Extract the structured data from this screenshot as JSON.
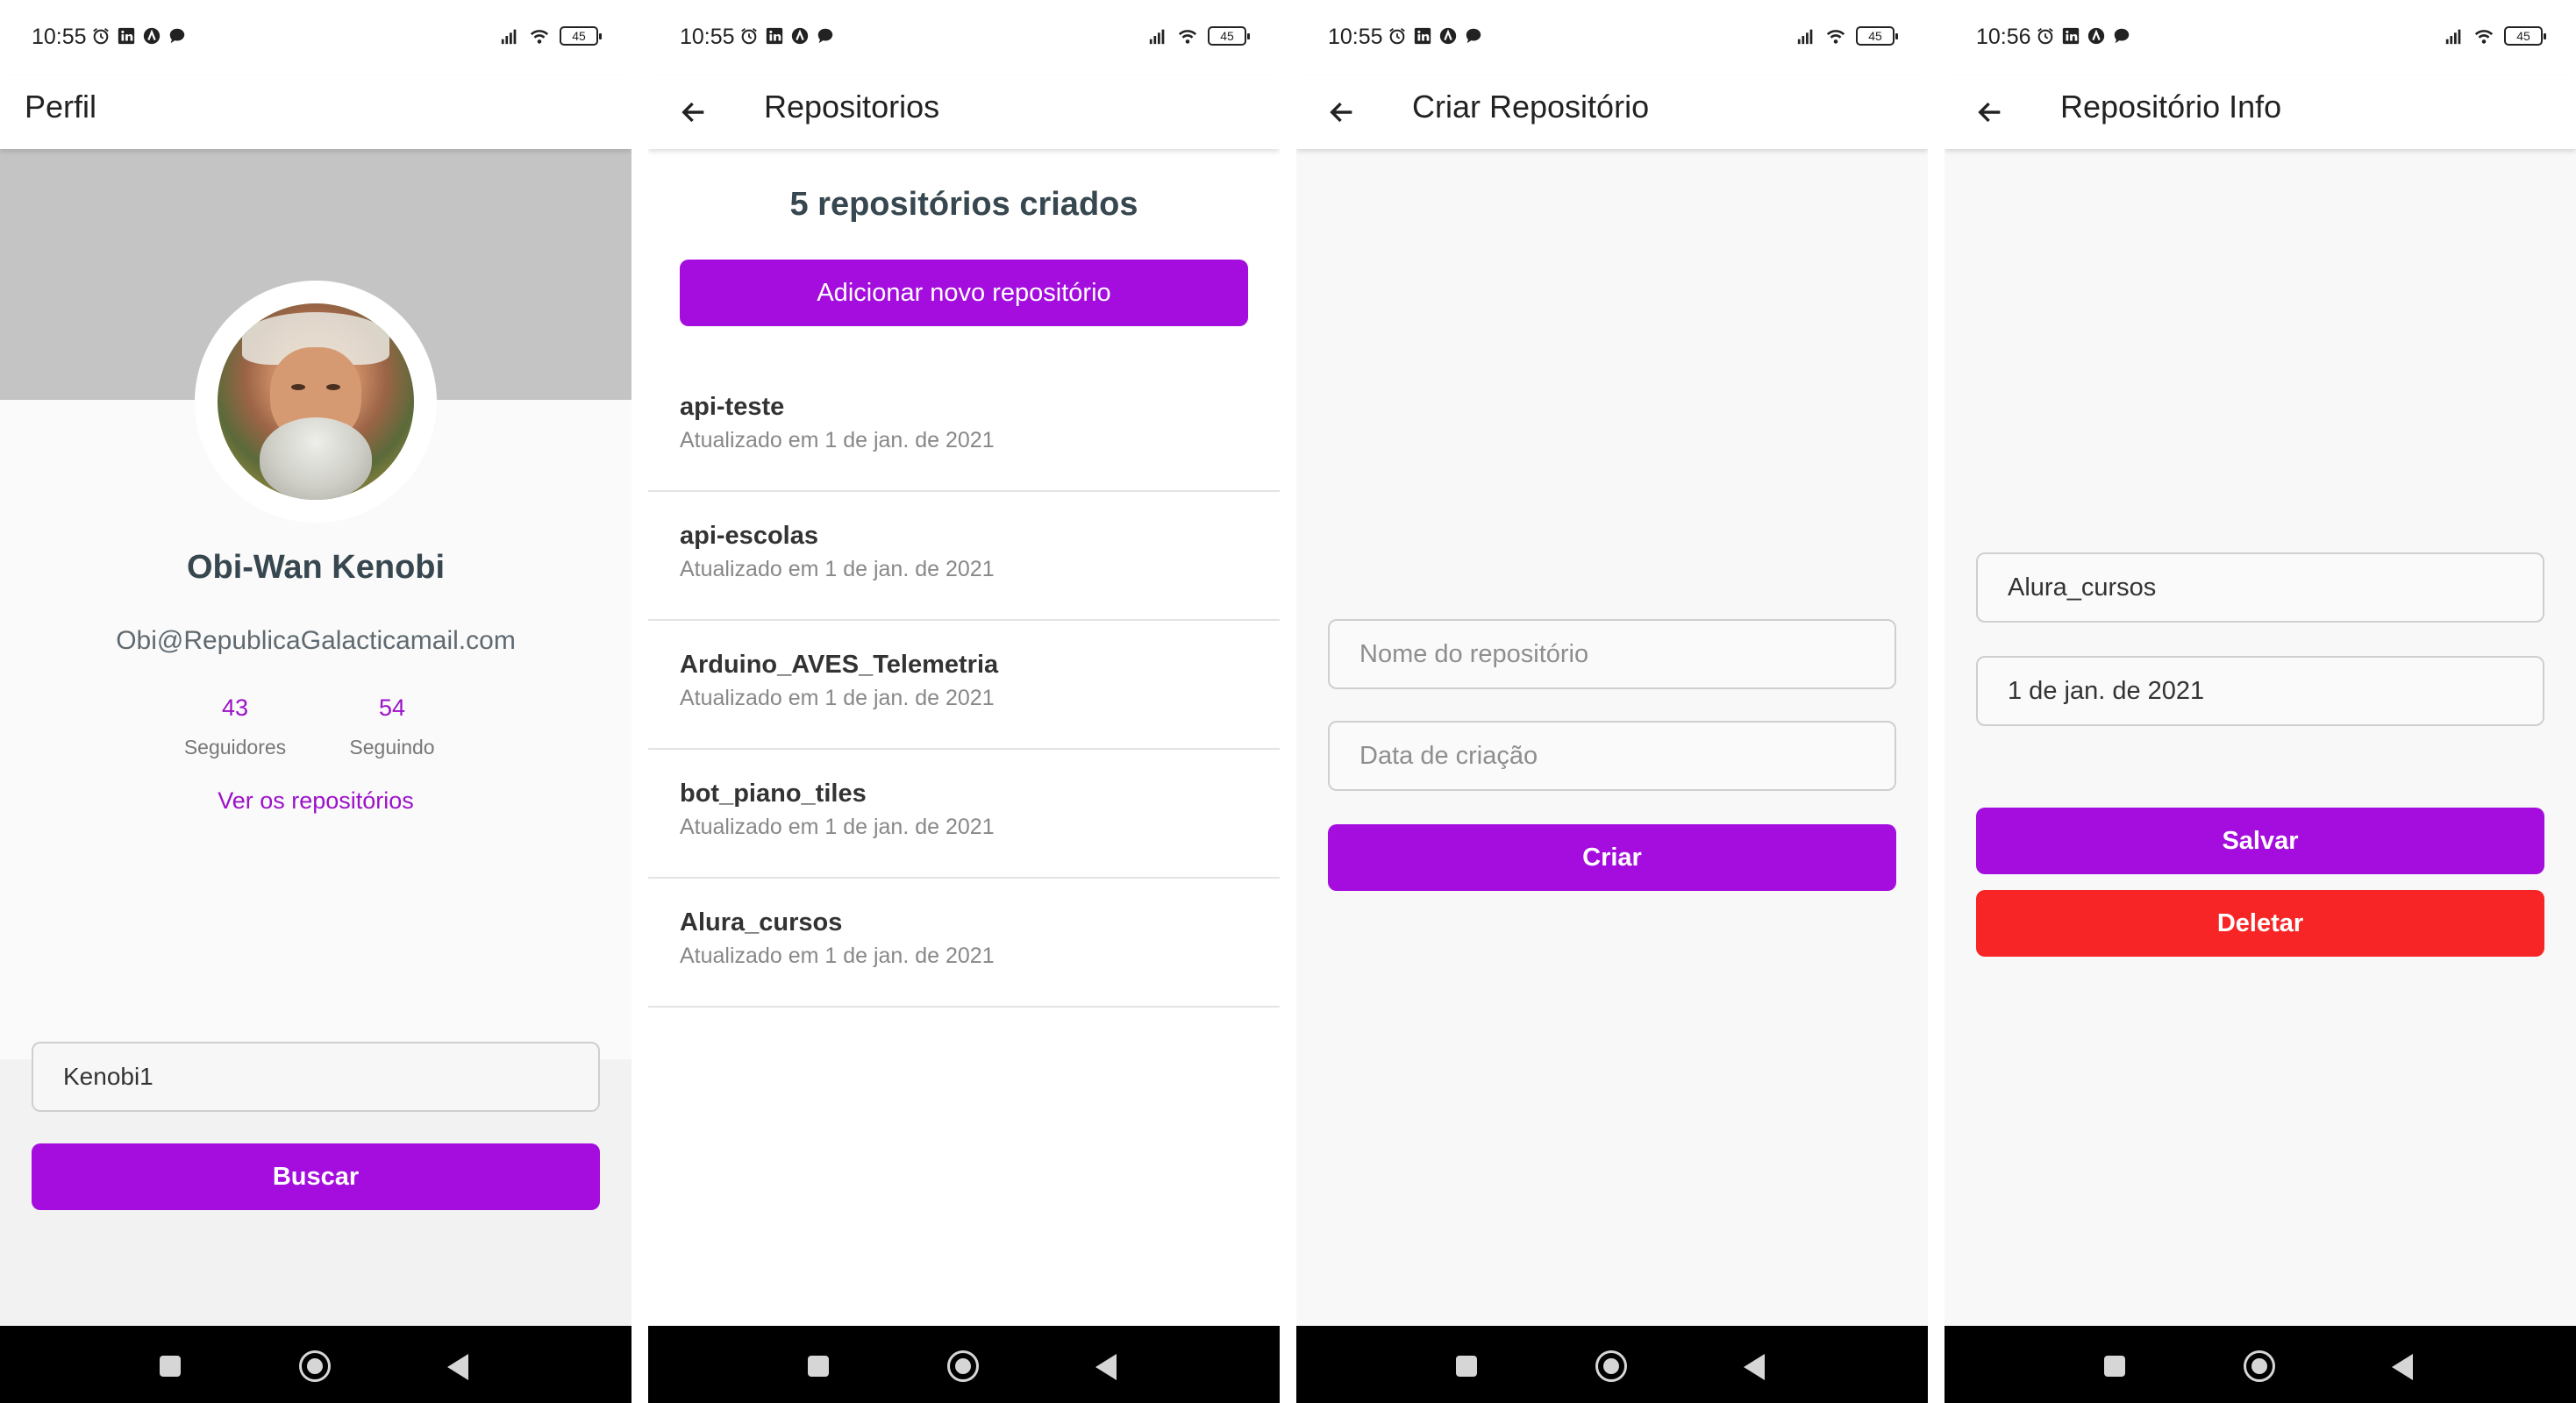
{
  "colors": {
    "accent": "#a40ddd",
    "danger": "#f72525",
    "header_gray": "#c4c4c4",
    "name_text": "#37474f"
  },
  "status": {
    "times": [
      "10:55",
      "10:55",
      "10:55",
      "10:56"
    ],
    "battery": "45",
    "icons_left": [
      "alarm-icon",
      "linkedin-icon",
      "app-icon",
      "chat-icon"
    ],
    "icons_right": [
      "signal-icon",
      "wifi-icon",
      "battery-icon"
    ]
  },
  "screen1": {
    "title": "Perfil",
    "name": "Obi-Wan Kenobi",
    "email": "Obi@RepublicaGalacticamail.com",
    "followers_count": "43",
    "followers_label": "Seguidores",
    "following_count": "54",
    "following_label": "Seguindo",
    "view_repos": "Ver os repositórios",
    "search_value": "Kenobi1",
    "search_button": "Buscar"
  },
  "screen2": {
    "title": "Repositorios",
    "count_text": "5 repositórios criados",
    "add_button": "Adicionar novo repositório",
    "repos": [
      {
        "name": "api-teste",
        "updated": "Atualizado em 1 de jan. de 2021"
      },
      {
        "name": "api-escolas",
        "updated": "Atualizado em 1 de jan. de 2021"
      },
      {
        "name": "Arduino_AVES_Telemetria",
        "updated": "Atualizado em 1 de jan. de 2021"
      },
      {
        "name": "bot_piano_tiles",
        "updated": "Atualizado em 1 de jan. de 2021"
      },
      {
        "name": "Alura_cursos",
        "updated": "Atualizado em 1 de jan. de 2021"
      }
    ]
  },
  "screen3": {
    "title": "Criar Repositório",
    "name_placeholder": "Nome do repositório",
    "date_placeholder": "Data de criação",
    "create_button": "Criar"
  },
  "screen4": {
    "title": "Repositório Info",
    "name_value": "Alura_cursos",
    "date_value": "1 de jan. de 2021",
    "save_button": "Salvar",
    "delete_button": "Deletar"
  }
}
